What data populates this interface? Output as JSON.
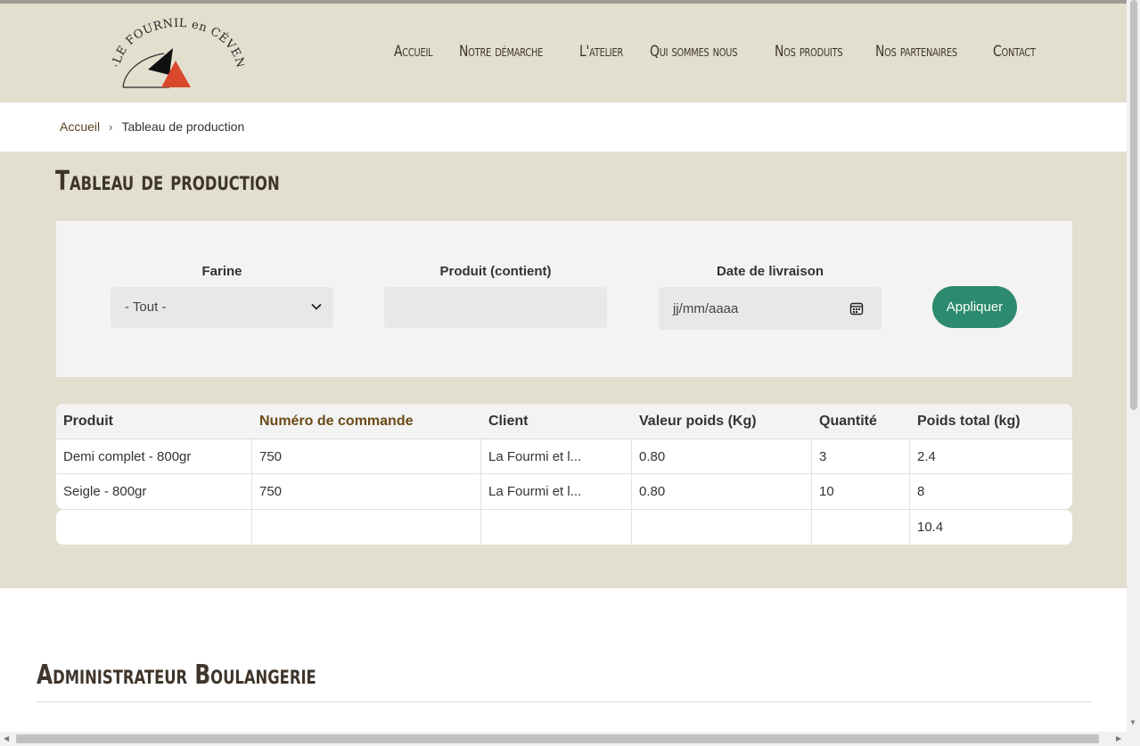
{
  "header": {
    "logo_text": "LE FOURNIL en CÉVENNES",
    "nav": [
      "Accueil",
      "Notre démarche",
      "L'atelier",
      "Qui sommes nous",
      "Nos produits",
      "Nos partenaires",
      "Contact"
    ]
  },
  "breadcrumb": {
    "home": "Accueil",
    "separator": "›",
    "current": "Tableau de production"
  },
  "page_title": "Tableau de production",
  "filters": {
    "flour_label": "Farine",
    "flour_value": "- Tout -",
    "product_label": "Produit (contient)",
    "product_value": "",
    "date_label": "Date de livraison",
    "date_placeholder": "jj/mm/aaaa",
    "apply_label": "Appliquer"
  },
  "table": {
    "headers": [
      "Produit",
      "Numéro de commande",
      "Client",
      "Valeur poids (Kg)",
      "Quantité",
      "Poids total (kg)"
    ],
    "rows": [
      [
        "Demi complet - 800gr",
        "750",
        "La Fourmi et l...",
        "0.80",
        "3",
        "2.4"
      ],
      [
        "Seigle - 800gr",
        "750",
        "La Fourmi et l...",
        "0.80",
        "10",
        "8"
      ]
    ],
    "total": "10.4"
  },
  "section_title": "Administrateur Boulangerie",
  "colors": {
    "beige": "#e2dfcf",
    "accent_green": "#2c8a6e",
    "title_brown": "#3f352b",
    "sort_link": "#6b4a17",
    "logo_orange": "#d9482b"
  },
  "icons": [
    "chevron-down-icon",
    "calendar-icon",
    "breadcrumb-chevron-icon"
  ]
}
